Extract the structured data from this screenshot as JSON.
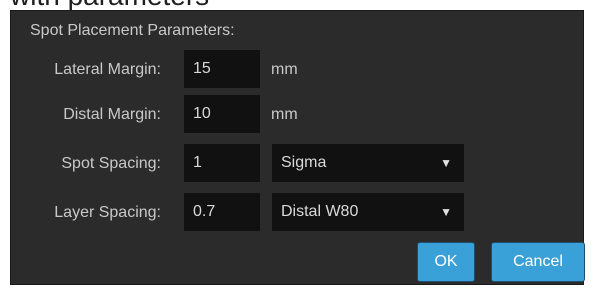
{
  "top_cut_text": "with parameters",
  "dialog": {
    "heading": "Spot Placement Parameters:",
    "fields": [
      {
        "label": "Lateral Margin:",
        "value": "15",
        "unit": "mm"
      },
      {
        "label": "Distal Margin:",
        "value": "10",
        "unit": "mm"
      },
      {
        "label": "Spot Spacing:",
        "value": "1",
        "select_value": "Sigma"
      },
      {
        "label": "Layer Spacing:",
        "value": "0.7",
        "select_value": "Distal W80"
      }
    ],
    "buttons": {
      "ok": "OK",
      "cancel": "Cancel"
    }
  },
  "icons": {
    "dropdown": "chevron-down-icon"
  },
  "colors": {
    "panel_bg": "#2b2b2b",
    "field_bg": "#111111",
    "text": "#c9c9c9",
    "button_bg": "#3aa0d8"
  }
}
